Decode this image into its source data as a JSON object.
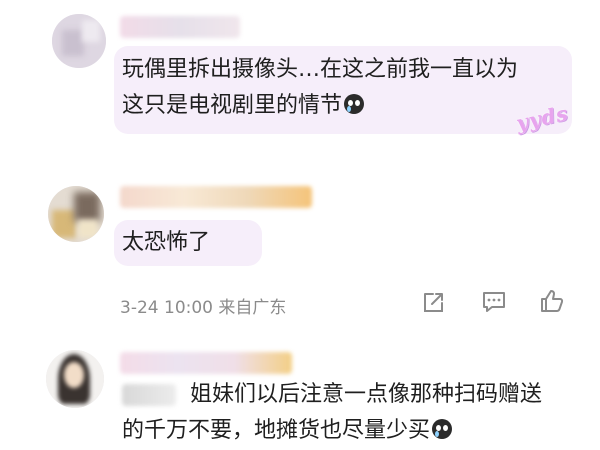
{
  "comments": [
    {
      "text_lines": [
        "玩偶里拆出摄像头…在这之前我一直以为",
        "这只是电视剧里的情节"
      ],
      "sticker_text": "yyds"
    },
    {
      "text_lines": [
        "太恐怖了"
      ],
      "meta": {
        "date": "3-24",
        "time": "10:00",
        "source": "来自广东"
      }
    },
    {
      "text_lines": [
        "姐妹们以后注意一点像那种扫码赠送",
        "的千万不要，地摊货也尽量少买"
      ]
    }
  ],
  "icons": {
    "share": "share-icon",
    "comment": "comment-icon",
    "like": "thumbs-up-icon",
    "crying": "crying-emoji-icon"
  },
  "colors": {
    "bubble": "#f6eefa",
    "meta_text": "#8b8b8b",
    "sticker": "#e8a4ee"
  }
}
